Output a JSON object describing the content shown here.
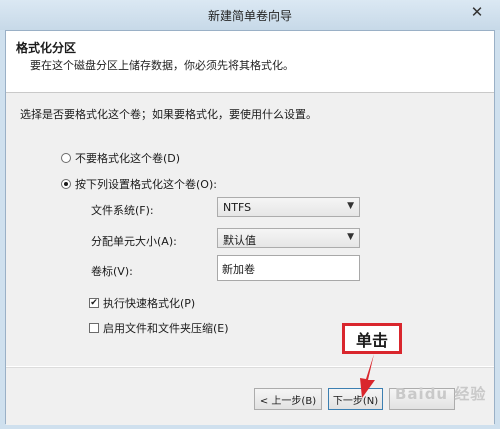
{
  "window": {
    "title": "新建简单卷向导",
    "close_glyph": "✕"
  },
  "header": {
    "title": "格式化分区",
    "subtitle": "要在这个磁盘分区上储存数据，你必须先将其格式化。"
  },
  "body": {
    "intro": "选择是否要格式化这个卷；如果要格式化，要使用什么设置。",
    "options": {
      "no_format": {
        "label": "不要格式化这个卷(D)",
        "selected": false
      },
      "format": {
        "label": "按下列设置格式化这个卷(O):",
        "selected": true
      }
    },
    "fields": {
      "filesystem": {
        "label": "文件系统(F):",
        "value": "NTFS"
      },
      "alloc_unit": {
        "label": "分配单元大小(A):",
        "value": "默认值"
      },
      "volume_label": {
        "label": "卷标(V):",
        "value": "新加卷"
      }
    },
    "checkboxes": {
      "quick_format": {
        "label": "执行快速格式化(P)",
        "checked": true
      },
      "compression": {
        "label": "启用文件和文件夹压缩(E)",
        "checked": false
      }
    }
  },
  "footer": {
    "back_label": "< 上一步(B)",
    "next_label": "下一步(N)"
  },
  "annotation": {
    "text": "单击",
    "color": "#d9262d"
  },
  "watermark": "Baidu 经验"
}
